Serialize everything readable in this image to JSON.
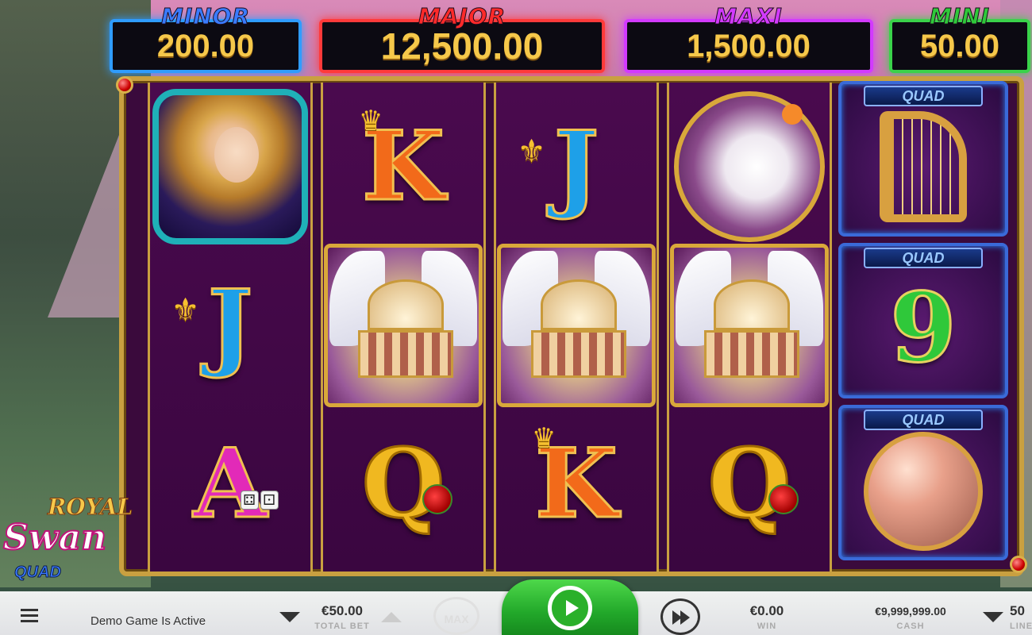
{
  "jackpots": {
    "minor": {
      "title": "MINOR",
      "value": "200.00"
    },
    "major": {
      "title": "MAJOR",
      "value": "12,500.00"
    },
    "maxi": {
      "title": "MAXI",
      "value": "1,500.00"
    },
    "mini": {
      "title": "MINI",
      "value": "50.00"
    }
  },
  "reels": [
    {
      "symbols": [
        "princess",
        "J",
        "A"
      ]
    },
    {
      "symbols": [
        "K",
        "temple",
        "Q"
      ]
    },
    {
      "symbols": [
        "J",
        "temple",
        "K"
      ]
    },
    {
      "symbols": [
        "swan",
        "temple",
        "Q"
      ]
    }
  ],
  "quad_reel": {
    "badge": "QUAD",
    "symbols": [
      "harp",
      "9",
      "peach"
    ]
  },
  "logo": {
    "royal": "ROYAL",
    "swan": "Swan",
    "quad": "QUAD"
  },
  "bottom_bar": {
    "demo_text": "Demo Game Is Active",
    "total_bet_value": "€50.00",
    "total_bet_label": "TOTAL BET",
    "max_label": "MAX",
    "win_value": "€0.00",
    "win_label": "WIN",
    "cash_value": "€9,999,999.00",
    "cash_label": "CASH",
    "lines_value": "50",
    "lines_label": "LINES"
  },
  "icons": {
    "menu": "menu-icon",
    "spin": "spin-icon",
    "autoplay": "autoplay-icon",
    "bet_down": "arrow-down-icon",
    "bet_up": "arrow-up-icon"
  },
  "colors": {
    "minor": "#2f9cff",
    "major": "#ff3a3a",
    "maxi": "#d23aff",
    "mini": "#3ad24a",
    "jackpot_value": "#f6c84a",
    "spin_button": "#22a82a"
  }
}
